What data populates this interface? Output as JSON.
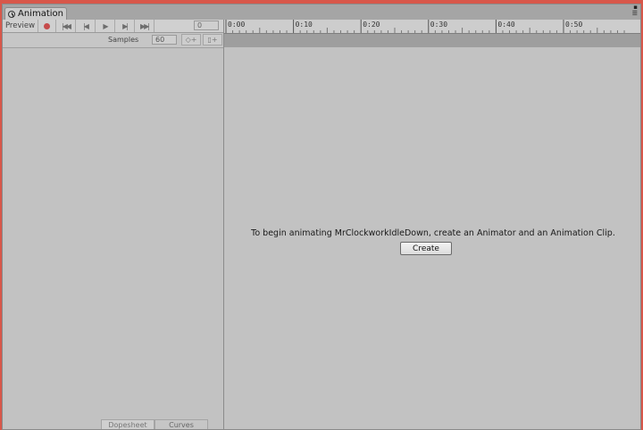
{
  "window": {
    "tab_title": "Animation",
    "controls": [
      "▪",
      "☰"
    ]
  },
  "toolbar": {
    "preview_label": "Preview",
    "record_color": "#c64b4b",
    "nav_glyphs": [
      "|◀◀",
      "|◀",
      "▶",
      "▶|",
      "▶▶|"
    ],
    "frame_value": "0"
  },
  "samples": {
    "label": "Samples",
    "value": "60",
    "add_key_glyph": "◇+",
    "add_event_glyph": "▯+"
  },
  "ruler": {
    "ticks": [
      "0:00",
      "0:10",
      "0:20",
      "0:30",
      "0:40",
      "0:50"
    ]
  },
  "main": {
    "message": "To begin animating MrClockworkIdleDown, create an Animator and an Animation Clip.",
    "create_label": "Create"
  },
  "bottom_tabs": [
    "Dopesheet",
    "Curves"
  ]
}
